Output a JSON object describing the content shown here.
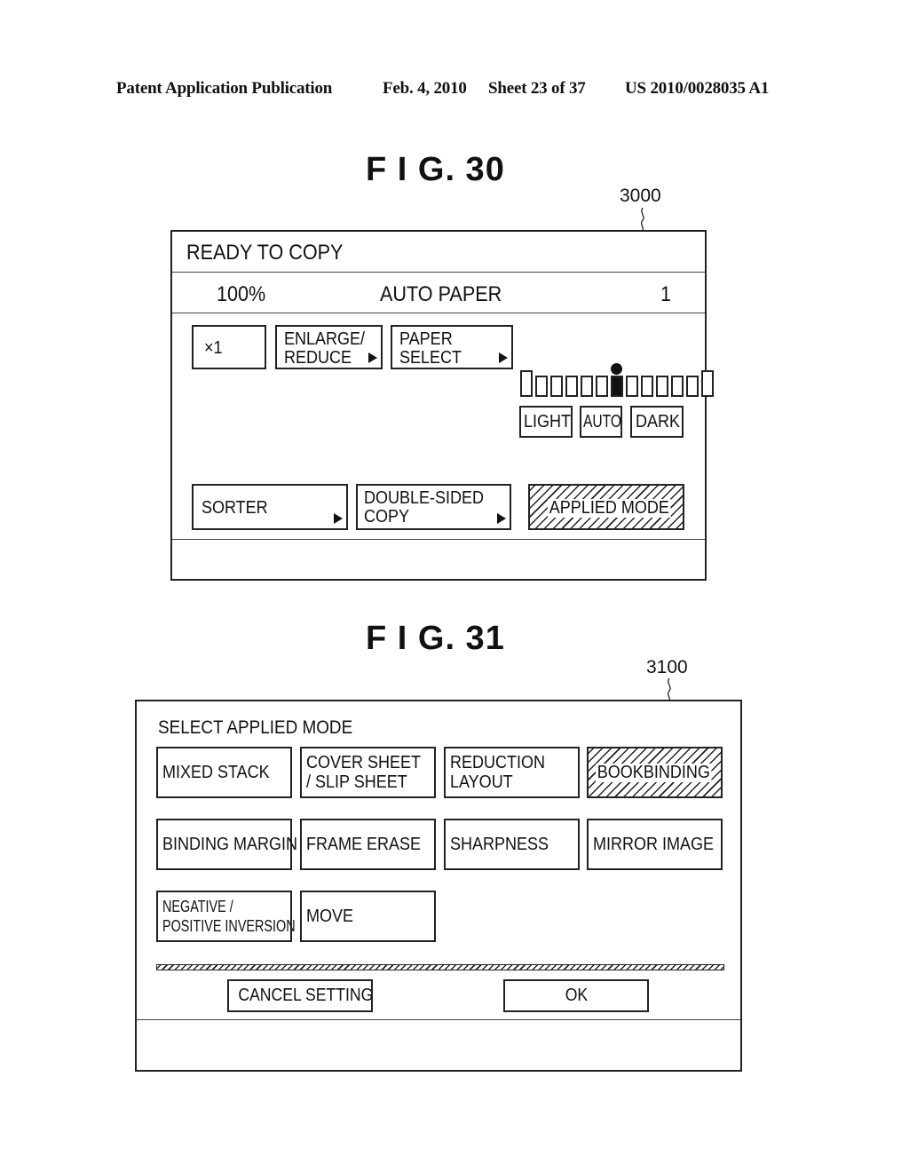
{
  "page_header": {
    "publication": "Patent Application Publication",
    "date": "Feb. 4, 2010",
    "sheet": "Sheet 23 of 37",
    "patent_number": "US 2010/0028035 A1"
  },
  "fig30": {
    "title": "F I G.  30",
    "ref_number": "3000",
    "status": "READY TO COPY",
    "info_bar": {
      "magnification": "100%",
      "paper": "AUTO PAPER",
      "copies": "1"
    },
    "buttons": {
      "copies_multiplier": "×1",
      "enlarge_reduce": [
        "ENLARGE/",
        "REDUCE"
      ],
      "paper_select": [
        "PAPER",
        "SELECT"
      ],
      "sorter": "SORTER",
      "double_sided": [
        "DOUBLE-SIDED",
        "COPY"
      ],
      "applied_mode": "APPLIED MODE"
    },
    "density": {
      "levels": 13,
      "selected_index": 6,
      "light_label": "LIGHT",
      "auto_label": "AUTO",
      "dark_label": "DARK"
    }
  },
  "fig31": {
    "title": "F I G.  31",
    "ref_number": "3100",
    "heading": "SELECT APPLIED MODE",
    "modes": [
      {
        "line1": "MIXED STACK",
        "line2": "",
        "selected": false
      },
      {
        "line1": "COVER SHEET",
        "line2": "/ SLIP SHEET",
        "selected": false
      },
      {
        "line1": "REDUCTION",
        "line2": "LAYOUT",
        "selected": false
      },
      {
        "line1": "BOOKBINDING",
        "line2": "",
        "selected": true
      },
      {
        "line1": "BINDING MARGIN",
        "line2": "",
        "selected": false
      },
      {
        "line1": "FRAME ERASE",
        "line2": "",
        "selected": false
      },
      {
        "line1": "SHARPNESS",
        "line2": "",
        "selected": false
      },
      {
        "line1": "MIRROR IMAGE",
        "line2": "",
        "selected": false
      },
      {
        "line1": "NEGATIVE /",
        "line2": "POSITIVE INVERSION",
        "selected": false
      },
      {
        "line1": "MOVE",
        "line2": "",
        "selected": false
      }
    ],
    "cancel_label": "CANCEL SETTING",
    "ok_label": "OK"
  }
}
